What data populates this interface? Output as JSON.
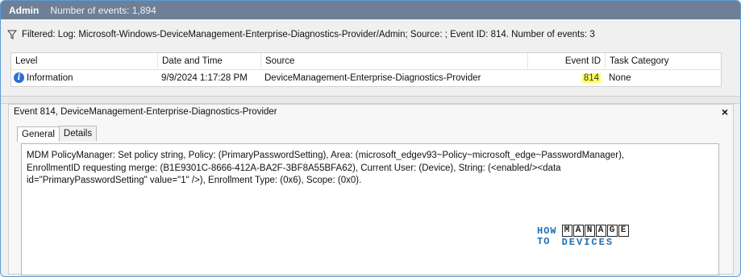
{
  "titlebar": {
    "name": "Admin",
    "count": "Number of events: 1,894"
  },
  "filter": {
    "text": "Filtered: Log: Microsoft-Windows-DeviceManagement-Enterprise-Diagnostics-Provider/Admin; Source: ; Event ID: 814. Number of events: 3"
  },
  "table": {
    "headers": {
      "level": "Level",
      "datetime": "Date and Time",
      "source": "Source",
      "eventid": "Event ID",
      "category": "Task Category"
    },
    "row": {
      "level": "Information",
      "datetime": "9/9/2024 1:17:28 PM",
      "source": "DeviceManagement-Enterprise-Diagnostics-Provider",
      "eventid": "814",
      "category": "None"
    }
  },
  "detail": {
    "title": "Event 814, DeviceManagement-Enterprise-Diagnostics-Provider",
    "close": "×",
    "tabs": {
      "general": "General",
      "details": "Details"
    },
    "message": "MDM PolicyManager: Set policy string, Policy: (PrimaryPasswordSetting), Area: (microsoft_edgev93~Policy~microsoft_edge~PasswordManager), EnrollmentID requesting merge: (B1E9301C-8666-412A-BA2F-3BF8A55BFA62), Current User: (Device), String: (<enabled/><data id=\"PrimaryPasswordSetting\" value=\"1\" />), Enrollment Type: (0x6), Scope: (0x0)."
  },
  "logo": {
    "how": "HOW",
    "to": "TO",
    "manage": [
      "M",
      "A",
      "N",
      "A",
      "G",
      "E"
    ],
    "devices": "DEVICES"
  },
  "colors": {
    "titlebar": "#6e7f96",
    "highlight": "#ffff66",
    "logo_blue": "#1f6fb2"
  }
}
